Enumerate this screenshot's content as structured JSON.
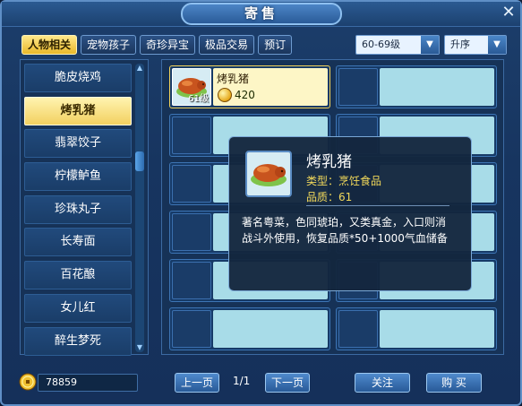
{
  "window": {
    "title": "寄售",
    "close_label": "✕"
  },
  "tabs": [
    {
      "label": "人物相关",
      "active": true
    },
    {
      "label": "宠物孩子",
      "active": false
    },
    {
      "label": "奇珍异宝",
      "active": false
    },
    {
      "label": "极品交易",
      "active": false
    },
    {
      "label": "预订",
      "active": false
    }
  ],
  "filters": {
    "level_value": "60-69级",
    "sort_value": "升序"
  },
  "item_list": [
    {
      "label": "脆皮烧鸡",
      "selected": false
    },
    {
      "label": "烤乳猪",
      "selected": true
    },
    {
      "label": "翡翠饺子",
      "selected": false
    },
    {
      "label": "柠檬鲈鱼",
      "selected": false
    },
    {
      "label": "珍珠丸子",
      "selected": false
    },
    {
      "label": "长寿面",
      "selected": false
    },
    {
      "label": "百花酿",
      "selected": false
    },
    {
      "label": "女儿红",
      "selected": false
    },
    {
      "label": "醉生梦死",
      "selected": false
    }
  ],
  "listing": {
    "name": "烤乳猪",
    "price": "420",
    "level": "61级"
  },
  "tooltip": {
    "name": "烤乳猪",
    "type_line": "类型：烹饪食品",
    "quality_line": "品质：61",
    "desc_1": "著名粤菜，色同琥珀，又类真金，入口则消",
    "desc_2": "战斗外使用，恢复品质*50+1000气血储备"
  },
  "bottom": {
    "money": "78859",
    "prev_label": "上一页",
    "page_label": "1/1",
    "next_label": "下一页",
    "follow_label": "关注",
    "buy_label": "购 买"
  },
  "colors": {
    "accent_gold": "#f1d85a",
    "panel_blue": "#163257",
    "frame_blue": "#5f8fc6"
  }
}
